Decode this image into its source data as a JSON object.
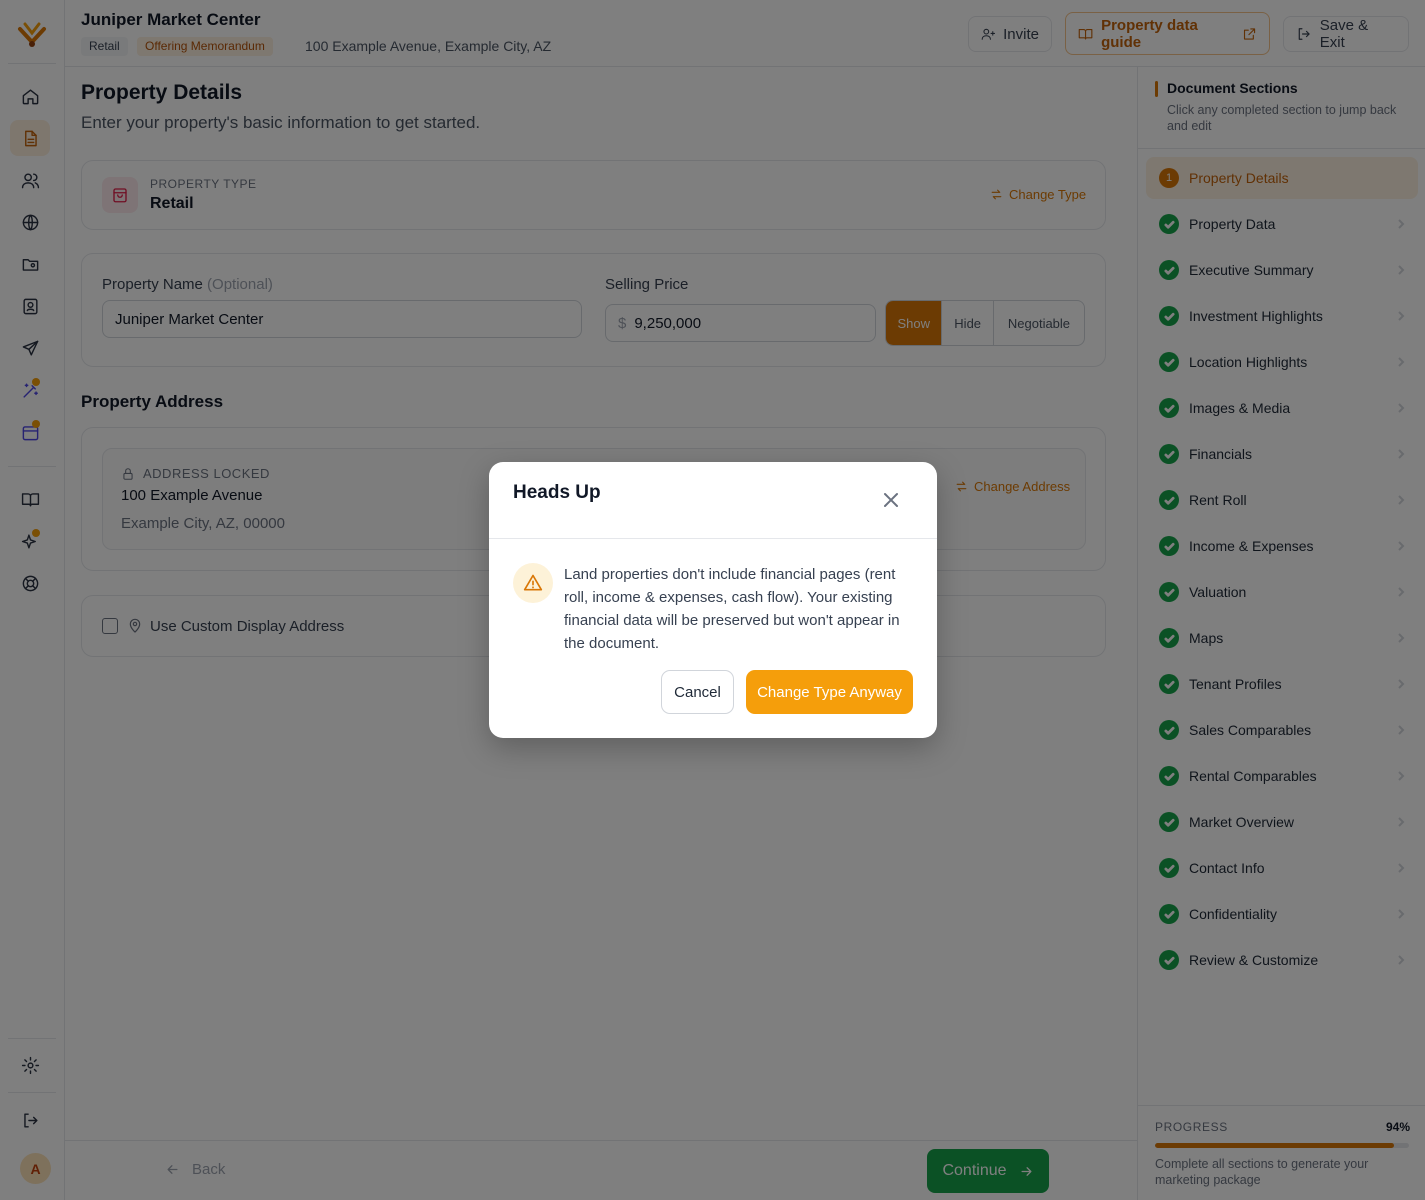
{
  "header": {
    "title": "Juniper Market Center",
    "tag_type": "Retail",
    "tag_doc": "Offering Memorandum",
    "address": "100 Example Avenue, Example City, AZ",
    "invite_label": "Invite",
    "guide_label": "Property data guide",
    "exit_label": "Save & Exit"
  },
  "main": {
    "title": "Property Details",
    "subtitle": "Enter your property's basic information to get started.",
    "property_type": {
      "label": "PROPERTY TYPE",
      "value": "Retail",
      "change_label": "Change Type"
    },
    "property_name": {
      "label": "Property Name",
      "optional": "(Optional)",
      "value": "Juniper Market Center"
    },
    "selling_price": {
      "label": "Selling Price",
      "currency": "$",
      "value": "9,250,000",
      "options": [
        "Show",
        "Hide",
        "Negotiable"
      ],
      "selected": "Show"
    },
    "address_section": {
      "title": "Property Address",
      "locked_label": "ADDRESS LOCKED",
      "line1": "100 Example Avenue",
      "line2": "Example City, AZ, 00000",
      "change_label": "Change Address"
    },
    "custom_address_label": "Use Custom Display Address"
  },
  "footer": {
    "back_label": "Back",
    "continue_label": "Continue"
  },
  "sections_panel": {
    "title": "Document Sections",
    "subtitle": "Click any completed section to jump back and edit",
    "items": [
      {
        "label": "Property Details",
        "state": "current",
        "number": "1"
      },
      {
        "label": "Property Data",
        "state": "done"
      },
      {
        "label": "Executive Summary",
        "state": "done"
      },
      {
        "label": "Investment Highlights",
        "state": "done"
      },
      {
        "label": "Location Highlights",
        "state": "done"
      },
      {
        "label": "Images & Media",
        "state": "done"
      },
      {
        "label": "Financials",
        "state": "done"
      },
      {
        "label": "Rent Roll",
        "state": "done"
      },
      {
        "label": "Income & Expenses",
        "state": "done"
      },
      {
        "label": "Valuation",
        "state": "done"
      },
      {
        "label": "Maps",
        "state": "done"
      },
      {
        "label": "Tenant Profiles",
        "state": "done"
      },
      {
        "label": "Sales Comparables",
        "state": "done"
      },
      {
        "label": "Rental Comparables",
        "state": "done"
      },
      {
        "label": "Market Overview",
        "state": "done"
      },
      {
        "label": "Contact Info",
        "state": "done"
      },
      {
        "label": "Confidentiality",
        "state": "done"
      },
      {
        "label": "Review & Customize",
        "state": "done"
      }
    ],
    "progress_label": "PROGRESS",
    "progress_value": "94%",
    "progress_fraction": 0.94,
    "progress_note": "Complete all sections to generate your marketing package"
  },
  "rail": {
    "avatar_initial": "A"
  },
  "modal": {
    "title": "Heads Up",
    "message": "Land properties don't include financial pages (rent roll, income & expenses, cash flow). Your existing financial data will be preserved but won't appear in the document.",
    "cancel_label": "Cancel",
    "confirm_label": "Change Type Anyway"
  },
  "colors": {
    "accent": "#d97706",
    "success": "#16a34a",
    "confirm": "#f59e0b"
  }
}
